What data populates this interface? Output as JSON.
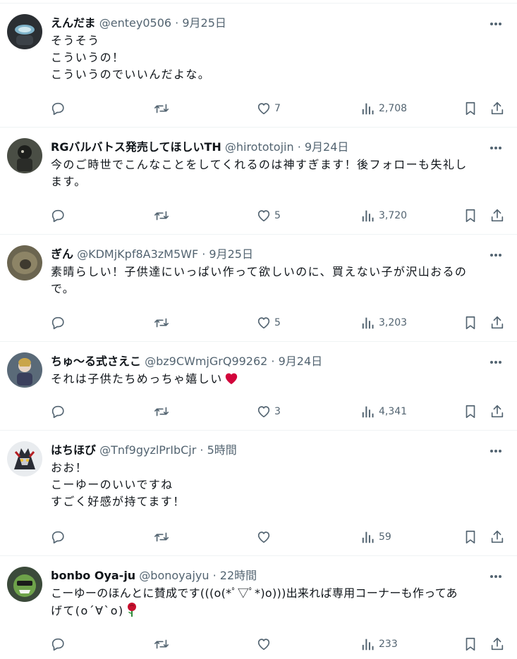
{
  "colors": {
    "text": "#0f1419",
    "secondary": "#536471",
    "divider": "#eff3f4",
    "heart_emoji": "#d2043b",
    "rose_emoji": "#c8102e"
  },
  "posts": [
    {
      "name": "えんだま",
      "meta": "@entey0506 · 9月25日",
      "lines": [
        "そうそう",
        "こういうの！",
        "こういうのでいいんだよな。"
      ],
      "likes": "7",
      "views": "2,708"
    },
    {
      "name": "RGバルバトス発売してほしいTH",
      "meta": "@hirototojin · 9月24日",
      "lines": [
        "今のご時世でこんなことをしてくれるのは神すぎます！後フォローも失礼し",
        "ます。"
      ],
      "likes": "5",
      "views": "3,720"
    },
    {
      "name": "ぎん",
      "meta": "@KDMjKpf8A3zM5WF · 9月25日",
      "lines": [
        "素晴らしい！子供達にいっぱい作って欲しいのに、買えない子が沢山おるの",
        "で。"
      ],
      "likes": "5",
      "views": "3,203"
    },
    {
      "name": "ちゅ～る式さえこ",
      "meta": "@bz9CWmjGrQ99262 · 9月24日",
      "lines": [
        "それは子供たちめっちゃ嬉しい"
      ],
      "likes": "3",
      "views": "4,341"
    },
    {
      "name": "はちほび",
      "meta": "@Tnf9gyzlPrIbCjr · 5時間",
      "lines": [
        "おお！",
        "こーゆーのいいですね",
        "すごく好感が持てます！"
      ],
      "likes": "",
      "views": "59"
    },
    {
      "name": "bonbo Oya-ju",
      "meta": "@bonoyajyu · 22時間",
      "lines": [
        "こーゆーのほんとに賛成です(((o(*ﾟ▽ﾟ*)o)))出来れば専用コーナーも作ってあ",
        "げて(o´∀`o)"
      ],
      "likes": "",
      "views": "233"
    }
  ]
}
